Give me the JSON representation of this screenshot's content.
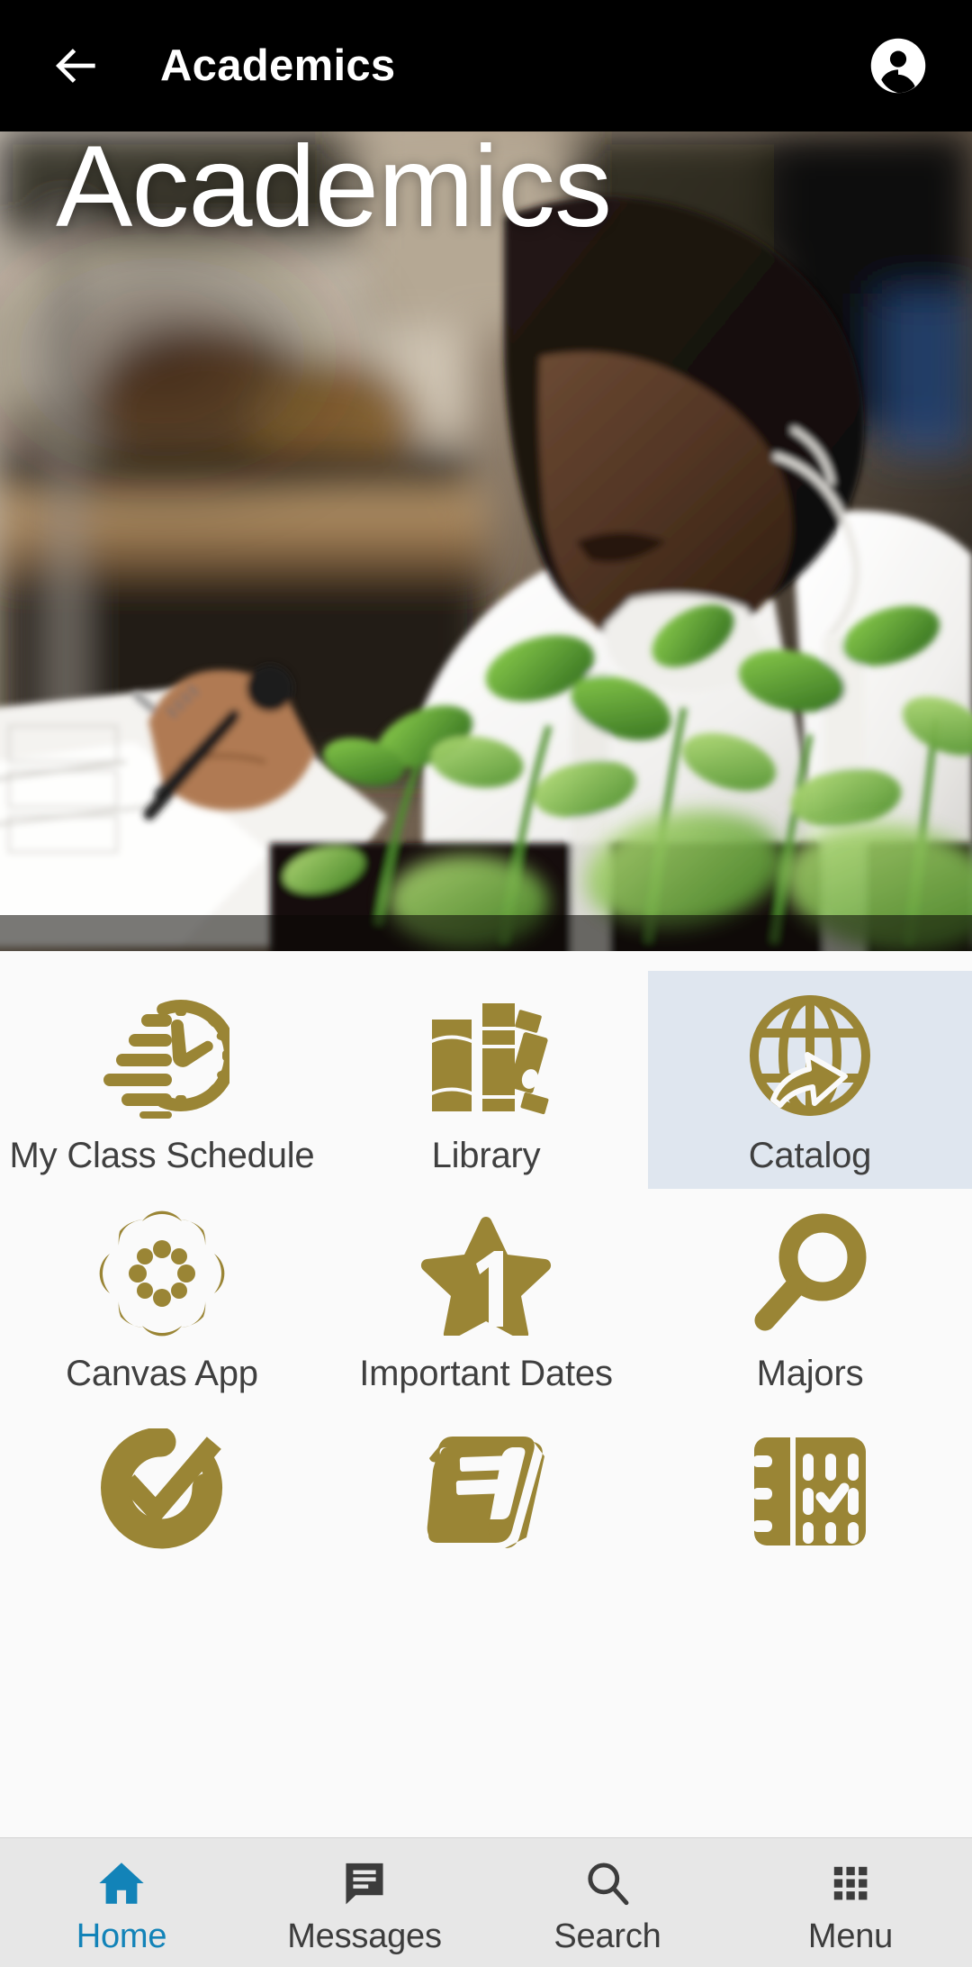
{
  "theme": {
    "appbar_bg": "#000000",
    "appbar_text": "#ffffff",
    "icon_gold": "#9a8535",
    "focus_bg": "#dfe6ef",
    "page_bg": "#fafafa",
    "nav_bg": "#e7e7e7",
    "nav_active": "#1283b8",
    "nav_inactive": "#3c3c3c",
    "label_text": "#3f3f3f"
  },
  "appbar": {
    "back_label": "Back",
    "back_icon": "arrow-left-icon",
    "title": "Academics",
    "account_icon": "account-circle-icon"
  },
  "hero": {
    "title": "Academics",
    "image_alt": "Student in white lab coat and face mask writing notes beside green seedlings in a laboratory"
  },
  "grid": {
    "items": [
      {
        "label": "My Class Schedule",
        "icon": "clock-speed-icon",
        "focused": false
      },
      {
        "label": "Library",
        "icon": "books-icon",
        "focused": false
      },
      {
        "label": "Catalog",
        "icon": "globe-arrow-icon",
        "focused": true
      },
      {
        "label": "Canvas App",
        "icon": "canvas-logo-icon",
        "focused": false
      },
      {
        "label": "Important Dates",
        "icon": "star-one-icon",
        "focused": false
      },
      {
        "label": "Majors",
        "icon": "magnifier-icon",
        "focused": false
      },
      {
        "label": "",
        "icon": "check-circle-icon",
        "focused": false
      },
      {
        "label": "",
        "icon": "book-closed-icon",
        "focused": false
      },
      {
        "label": "",
        "icon": "planner-check-icon",
        "focused": false
      }
    ]
  },
  "bottomnav": {
    "items": [
      {
        "label": "Home",
        "icon": "home-icon",
        "active": true
      },
      {
        "label": "Messages",
        "icon": "message-icon",
        "active": false
      },
      {
        "label": "Search",
        "icon": "search-icon",
        "active": false
      },
      {
        "label": "Menu",
        "icon": "grid-menu-icon",
        "active": false
      }
    ]
  }
}
